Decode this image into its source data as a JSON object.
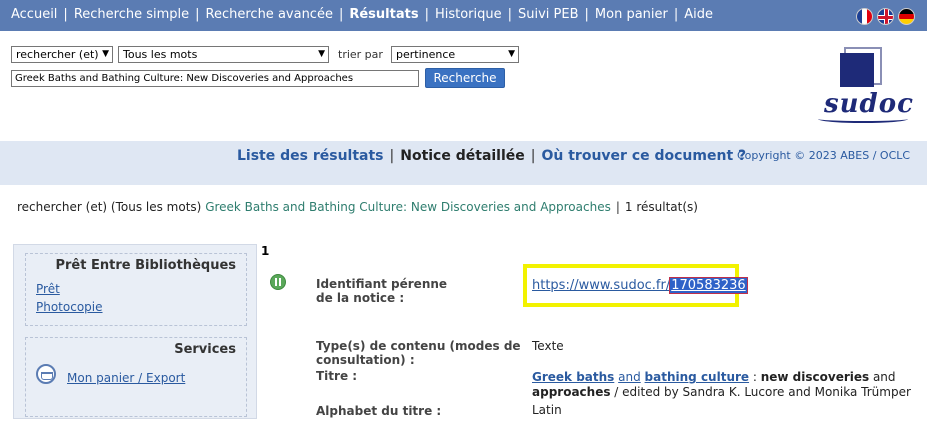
{
  "topnav": {
    "items": [
      "Accueil",
      "Recherche simple",
      "Recherche avancée",
      "Résultats",
      "Historique",
      "Suivi PEB",
      "Mon panier",
      "Aide"
    ],
    "active": "Résultats",
    "separator": "|"
  },
  "flags": [
    "flag-fr-icon",
    "flag-uk-icon",
    "flag-de-icon"
  ],
  "search": {
    "operator": "rechercher (et)",
    "field": "Tous les mots",
    "sort_label": "trier par",
    "sort_value": "pertinence",
    "query": "Greek Baths and Bathing Culture: New Discoveries and Approaches",
    "button_label": "Recherche"
  },
  "logo": {
    "text": "sudoc"
  },
  "band": {
    "nav": [
      "Liste des résultats",
      "Notice détaillée",
      "Où trouver ce document ?"
    ],
    "separator": "|",
    "copyright": "Copyright © 2023 ABES / OCLC"
  },
  "criteria": {
    "prefix": "rechercher (et) (Tous les mots)",
    "query": "Greek Baths and Bathing Culture: New Discoveries and Approaches",
    "separator": "|",
    "count": "1 résultat(s)"
  },
  "sidebar": {
    "peb_title": "Prêt Entre Bibliothèques",
    "peb_links": [
      "Prêt",
      "Photocopie"
    ],
    "services_title": "Services",
    "services_link": "Mon panier / Export"
  },
  "record": {
    "number": "1",
    "permalink_label_1": "Identifiant pérenne",
    "permalink_label_2": "de la notice :",
    "permalink_base": "https://www.sudoc.fr/",
    "permalink_id": "170583236",
    "content_type_label_1": "Type(s) de contenu (modes de",
    "content_type_label_2": "consultation) :",
    "content_type_value": "Texte",
    "title_label": "Titre :",
    "title_main_1": "Greek baths",
    "title_main_2": "and",
    "title_main_3": "bathing culture",
    "title_colon": " : ",
    "title_sub_1": "new discoveries",
    "title_sub_2": " and ",
    "title_sub_3": "approaches",
    "title_resp": " / edited by Sandra K. Lucore and Monika Trümper",
    "alphabet_label": "Alphabet du titre :",
    "alphabet_value": "Latin"
  },
  "colors": {
    "topbar": "#5b7cb3",
    "band": "#dfe7f3",
    "link": "#2a5aa0",
    "highlight_box": "#f2f200",
    "query_text": "#2e7d6e"
  }
}
